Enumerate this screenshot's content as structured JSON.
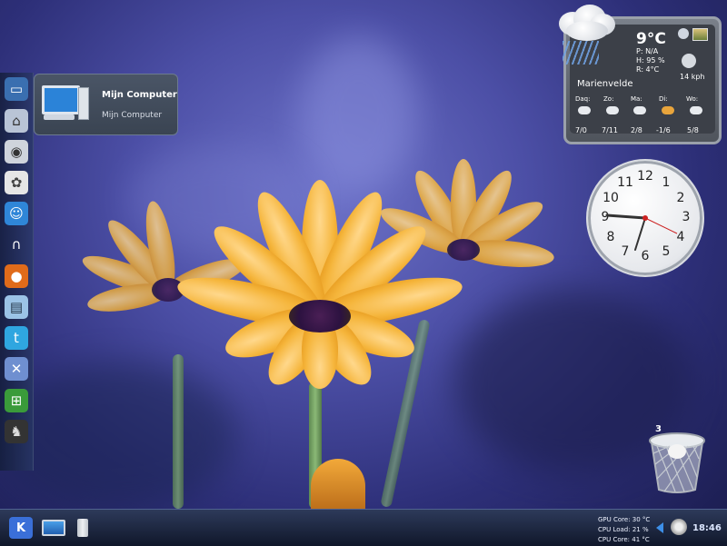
{
  "tooltip": {
    "title": "Mijn Computer",
    "subtitle": "Mijn Computer"
  },
  "launcher": {
    "items": [
      {
        "name": "computer-icon"
      },
      {
        "name": "home-icon"
      },
      {
        "name": "drive-icon"
      },
      {
        "name": "wine-icon"
      },
      {
        "name": "user-icon"
      },
      {
        "name": "headphones-icon"
      },
      {
        "name": "firefox-icon"
      },
      {
        "name": "document-icon"
      },
      {
        "name": "twitter-icon"
      },
      {
        "name": "tools-icon"
      },
      {
        "name": "windows-icon"
      },
      {
        "name": "game-icon"
      }
    ]
  },
  "weather": {
    "temp": "9°C",
    "pressure": "P: N/A",
    "humidity": "H: 95 %",
    "realfeel": "R: 4°C",
    "wind": "14 kph",
    "city": "Marienvelde",
    "days": [
      {
        "label": "Daq:",
        "temps": "7/0"
      },
      {
        "label": "Zo:",
        "temps": "7/11"
      },
      {
        "label": "Ma:",
        "temps": "2/8"
      },
      {
        "label": "Di:",
        "temps": "-1/6"
      },
      {
        "label": "Wo:",
        "temps": "5/8"
      }
    ]
  },
  "clock": {
    "numbers": [
      "12",
      "1",
      "2",
      "3",
      "4",
      "5",
      "6",
      "7",
      "8",
      "9",
      "10",
      "11"
    ]
  },
  "trash": {
    "count": "3"
  },
  "taskbar": {
    "gpu": "GPU Core: 30 °C",
    "cpu_load": "CPU Load: 21 %",
    "cpu_core": "CPU Core: 41 °C",
    "time": "18:46"
  },
  "colors": {
    "accent": "#2b83d8",
    "panel": "#3c4048",
    "petal": "#f5b53b"
  }
}
